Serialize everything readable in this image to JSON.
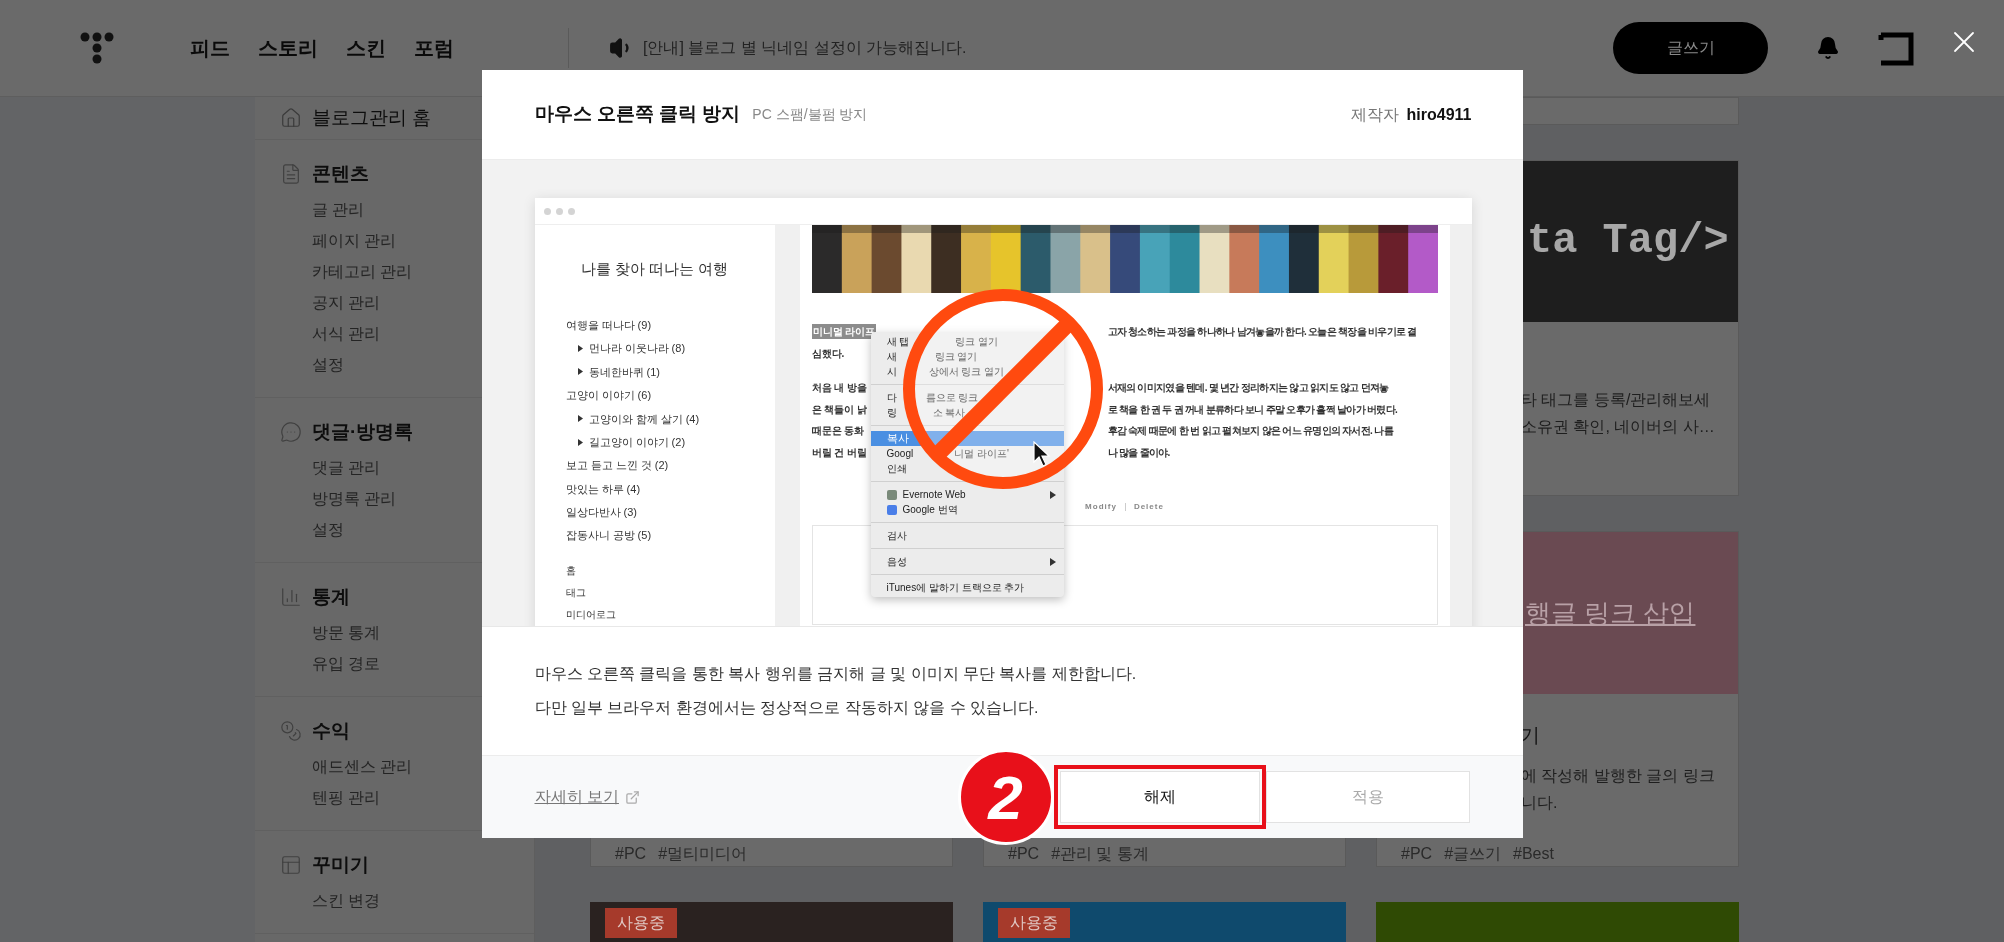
{
  "header": {
    "nav": [
      {
        "label": "피드"
      },
      {
        "label": "스토리"
      },
      {
        "label": "스킨"
      },
      {
        "label": "포럼"
      }
    ],
    "notice": "[안내] 블로그 별 닉네임 설정이 가능해집니다.",
    "write_button": "글쓰기"
  },
  "sidebar": {
    "home": "블로그관리 홈",
    "sections": [
      {
        "kind": "content",
        "title": "콘텐츠",
        "items": [
          "글 관리",
          "페이지 관리",
          "카테고리 관리",
          "공지 관리",
          "서식 관리",
          "설정"
        ]
      },
      {
        "kind": "comments",
        "title": "댓글·방명록",
        "items": [
          "댓글 관리",
          "방명록 관리",
          "설정"
        ]
      },
      {
        "kind": "stats",
        "title": "통계",
        "items": [
          "방문 통계",
          "유입 경로"
        ]
      },
      {
        "kind": "revenue",
        "title": "수익",
        "items": [
          "애드센스 관리",
          "텐핑 관리"
        ]
      },
      {
        "kind": "design",
        "title": "꾸미기",
        "items": [
          "스킨 변경"
        ]
      }
    ]
  },
  "card_rows": [
    [
      {
        "kind": "plain"
      }
    ],
    [
      {
        "kind": "code",
        "image_text": "ta Tag/>",
        "lines": [
          "타 태그를 등록/관리해보세",
          "소유권 확인, 네이버의 사…"
        ]
      }
    ],
    [
      {
        "kind": "plain",
        "tags": [
          "#PC",
          "#멀티미디어"
        ]
      },
      {
        "kind": "plain",
        "tags": [
          "#PC",
          "#관리 및 통계"
        ]
      },
      {
        "kind": "banner",
        "image_text": "행글 링크 삽입",
        "title": "기",
        "lines": [
          "에 작성해 발행한 글의 링크",
          "니다."
        ],
        "tags": [
          "#PC",
          "#글쓰기",
          "#Best"
        ]
      }
    ],
    [
      {
        "kind": "theme",
        "color": "#2a2220",
        "badge": "사용중"
      },
      {
        "kind": "theme",
        "color": "#0f4a6d",
        "badge": "사용중"
      },
      {
        "kind": "theme",
        "color": "#2f4a04"
      }
    ]
  ],
  "modal": {
    "title": "마우스 오른쪽 클릭 방지",
    "subtitle": "PC 스팸/불펌 방지",
    "author_label": "제작자",
    "author": "hiro4911",
    "preview": {
      "blog_title": "나를 찾아 떠나는 여행",
      "categories": [
        {
          "label": "여행을 떠나다 (9)",
          "children": [
            {
              "label": "먼나라 이웃나라 (8)"
            },
            {
              "label": "동네한바퀴 (1)"
            }
          ]
        },
        {
          "label": "고양이 이야기 (6)",
          "children": [
            {
              "label": "고양이와 함께 살기 (4)"
            },
            {
              "label": "길고양이 이야기 (2)"
            }
          ]
        },
        {
          "label": "보고 듣고 느낀 것 (2)"
        },
        {
          "label": "맛있는 하루 (4)"
        },
        {
          "label": "일상다반사 (3)"
        },
        {
          "label": "잡동사니 공방 (5)"
        }
      ],
      "links": [
        "홈",
        "태그",
        "미디어로그"
      ],
      "paragraphs": [
        [
          {
            "left": "미니멀 라이프",
            "right": "고자 청소하는 과정을 하나하나 남겨놓을까 한다. 오늘은 책장을 비우기로 결",
            "highlight": true
          },
          {
            "left": "심했다.",
            "highlight": false
          }
        ],
        [
          {
            "left": "처음 내 방을",
            "right": "서재의 이미지였을 텐데. 몇 년간 정리하지는 않고 읽지도 않고 던져놓",
            "highlight": false
          },
          {
            "left": "은 책들이 낡",
            "right": "로 책을 한 권 두 권 꺼내 분류하다 보니 주말 오후가 훌쩍 날아가 버렸다.",
            "highlight": false
          },
          {
            "left": "때문은 동화",
            "right": "후감 숙제 때문에 한 번 읽고 펼쳐보지 않은 어느 유명인의 자서전. 나름",
            "highlight": false
          },
          {
            "left": "버릴 건 버릴",
            "right": "나 많을 줄이야.",
            "highlight": false
          }
        ]
      ],
      "post_actions": [
        "Modify",
        "Delete"
      ],
      "menu": [
        [
          {
            "kind": "plain",
            "left": "새 탭",
            "right": "링크 열기",
            "selected": false
          },
          {
            "kind": "plain",
            "left": "새",
            "right": "링크 열기",
            "selected": false
          },
          {
            "kind": "plain",
            "left": "시",
            "right": "상에서 링크 열기",
            "selected": false
          }
        ],
        [
          {
            "kind": "plain",
            "left": "다",
            "right": "름으로 링크",
            "selected": false
          },
          {
            "kind": "plain",
            "left": "링",
            "right": "소 복사",
            "selected": false
          }
        ],
        [
          {
            "kind": "plain",
            "left": "복사",
            "selected": true
          },
          {
            "kind": "plain",
            "left": "Googl",
            "right": "니멀 라이프'",
            "selected": false
          },
          {
            "kind": "plain",
            "left": "인쇄",
            "selected": false
          }
        ],
        [
          {
            "kind": "evernote",
            "left": "Evernote Web",
            "submenu": true,
            "selected": false
          },
          {
            "kind": "translate",
            "left": "Google 번역",
            "selected": false
          }
        ],
        [
          {
            "kind": "plain",
            "left": "검사",
            "selected": false
          }
        ],
        [
          {
            "kind": "plain",
            "left": "음성",
            "submenu": true,
            "selected": false
          }
        ],
        [
          {
            "kind": "plain",
            "left": "iTunes에 말하기 트랙으로 추가",
            "selected": false
          }
        ]
      ]
    },
    "description": [
      "마우스 오른쪽 클릭을 통한 복사 행위를 금지해 글 및 이미지 무단 복사를 제한합니다.",
      "다만 일부 브라우저 환경에서는 정상적으로 작동하지 않을 수 있습니다."
    ],
    "more_link": "자세히 보기",
    "annotation_label": "2",
    "buttons": [
      {
        "label": "해제",
        "disabled": false,
        "annotated": true
      },
      {
        "label": "적용",
        "disabled": true,
        "annotated": false
      }
    ]
  }
}
